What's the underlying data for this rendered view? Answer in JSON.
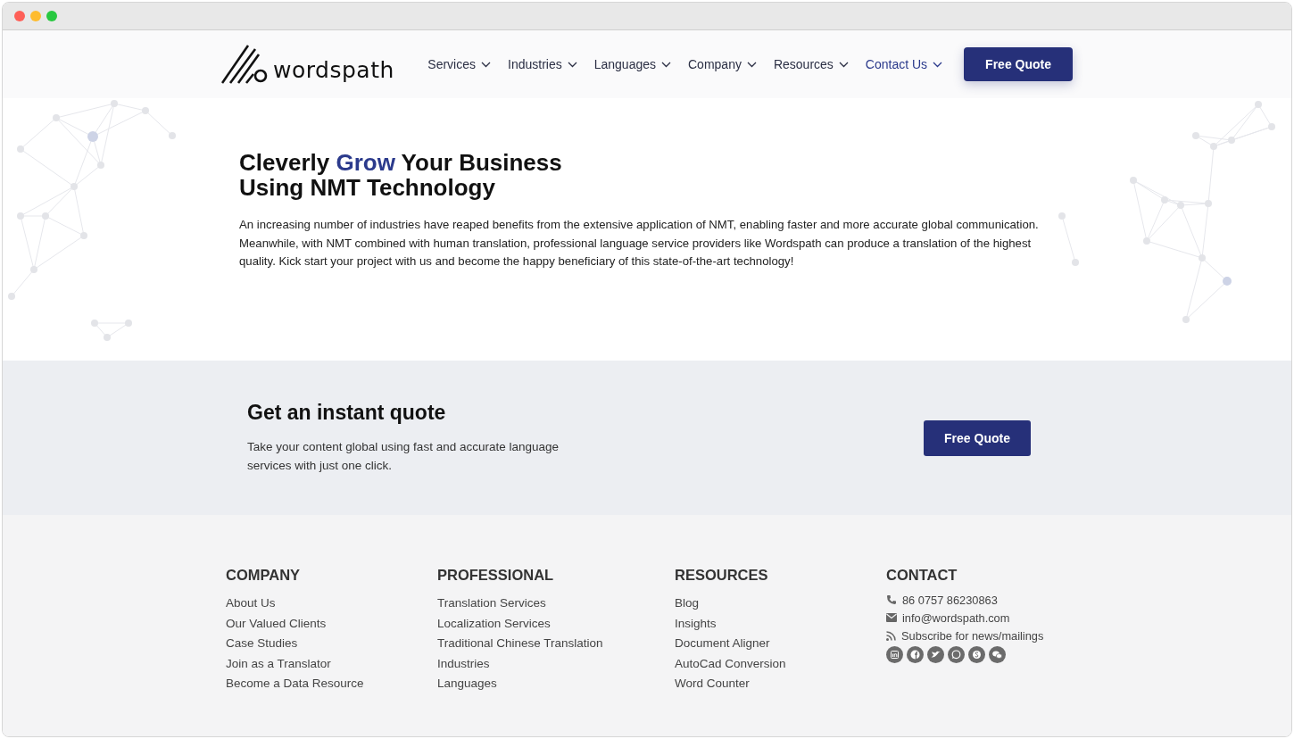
{
  "header": {
    "logo_text": "wordspath",
    "nav": [
      {
        "label": "Services",
        "selected": false
      },
      {
        "label": "Industries",
        "selected": false
      },
      {
        "label": "Languages",
        "selected": false
      },
      {
        "label": "Company",
        "selected": false
      },
      {
        "label": "Resources",
        "selected": false
      },
      {
        "label": "Contact Us",
        "selected": true
      }
    ],
    "cta": "Free Quote"
  },
  "hero": {
    "title_lines": [
      [
        {
          "text": "Cleverly ",
          "highlight": false
        },
        {
          "text": "Grow",
          "highlight": true
        },
        {
          "text": " Your Business",
          "highlight": false
        }
      ],
      [
        {
          "text": "Using NMT Technology",
          "highlight": false
        }
      ]
    ],
    "body": "An increasing number of industries have reaped benefits from the extensive application of NMT, enabling faster and more accurate global communication. Meanwhile, with NMT combined with human translation, professional language service providers like Wordspath can produce a translation of the highest quality. Kick start your project with us and become the happy beneficiary of this state-of-the-art technology!"
  },
  "quote_band": {
    "title": "Get an instant quote",
    "text": "Take your content global using fast and accurate language services with just one click.",
    "button": "Free Quote"
  },
  "footer": {
    "columns": [
      {
        "heading": "COMPANY",
        "links": [
          "About Us",
          "Our Valued Clients",
          "Case Studies",
          "Join as a Translator",
          "Become a Data Resource"
        ]
      },
      {
        "heading": "PROFESSIONAL",
        "links": [
          "Translation Services",
          "Localization Services",
          "Traditional Chinese Translation",
          "Industries",
          "Languages"
        ]
      },
      {
        "heading": "RESOURCES",
        "links": [
          "Blog",
          "Insights",
          "Document Aligner",
          "AutoCad Conversion",
          "Word Counter"
        ]
      }
    ],
    "contact": {
      "heading": "CONTACT",
      "items": [
        {
          "kind": "phone",
          "text": "86 0757 86230863"
        },
        {
          "kind": "email",
          "text": "info@wordspath.com"
        },
        {
          "kind": "rss",
          "text": "Subscribe for news/mailings"
        }
      ]
    }
  }
}
